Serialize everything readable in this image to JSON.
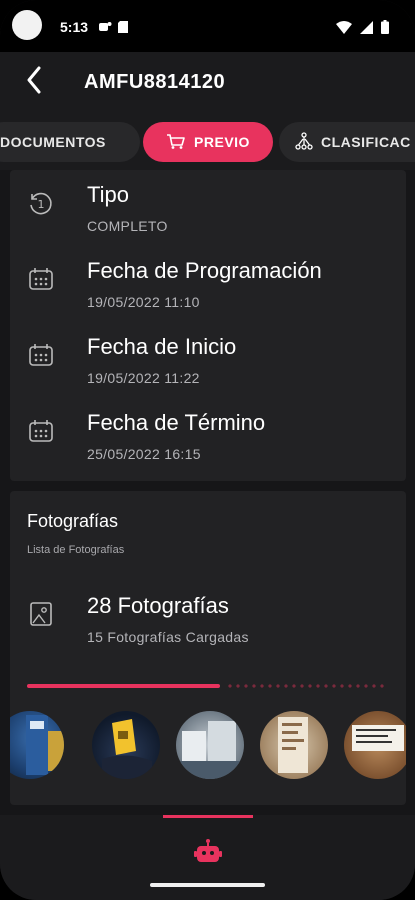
{
  "status_bar": {
    "time": "5:13",
    "icons": [
      "camera-dot",
      "notification-icon",
      "sd-card-icon",
      "wifi-icon",
      "signal-icon",
      "battery-icon"
    ]
  },
  "app_bar": {
    "title": "AMFU8814120",
    "back_icon": "chevron-left-icon"
  },
  "tabs": [
    {
      "label": "DOCUMENTOS",
      "selected": false
    },
    {
      "label": "PREVIO",
      "icon": "cart-icon",
      "selected": true
    },
    {
      "label": "CLASIFICAC",
      "icon": "hierarchy-icon",
      "selected": false
    }
  ],
  "details": [
    {
      "label": "Tipo",
      "value": "COMPLETO",
      "icon": "history-icon"
    },
    {
      "label": "Fecha de Programación",
      "value": "19/05/2022 11:10",
      "icon": "calendar-icon"
    },
    {
      "label": "Fecha de Inicio",
      "value": "19/05/2022 11:22",
      "icon": "calendar-icon"
    },
    {
      "label": "Fecha de Término",
      "value": "25/05/2022 16:15",
      "icon": "calendar-icon"
    }
  ],
  "photos": {
    "title": "Fotografías",
    "subtitle": "Lista de Fotografías",
    "count_label": "28 Fotografías",
    "loaded_label": "15 Fotografías Cargadas",
    "icon": "image-icon",
    "progress_fraction": 0.54
  },
  "colors": {
    "accent": "#e8335e",
    "background": "#161618",
    "card": "#222224",
    "bar": "#1b1b1d"
  },
  "bottom_nav": {
    "icon": "robot-icon"
  }
}
